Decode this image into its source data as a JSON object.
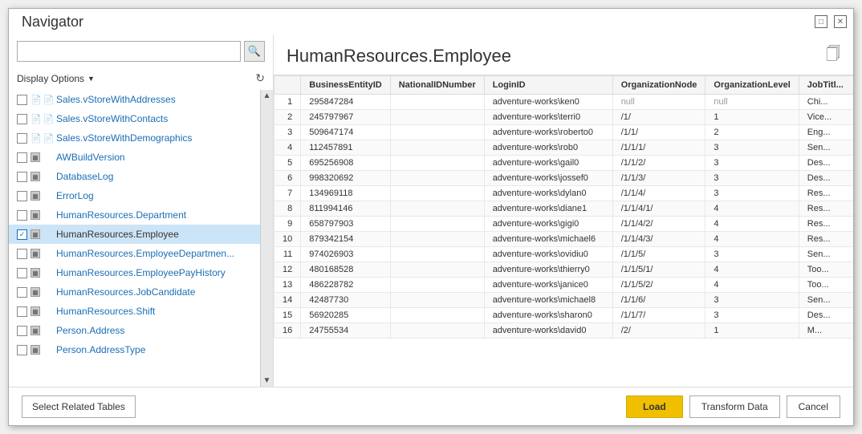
{
  "window": {
    "title": "Navigator"
  },
  "search": {
    "placeholder": "",
    "value": ""
  },
  "display_options": {
    "label": "Display Options",
    "arrow": "▼"
  },
  "list_items": [
    {
      "id": 1,
      "label": "Sales.vStoreWithAddresses",
      "checked": false,
      "type": "view",
      "truncated": true
    },
    {
      "id": 2,
      "label": "Sales.vStoreWithContacts",
      "checked": false,
      "type": "view"
    },
    {
      "id": 3,
      "label": "Sales.vStoreWithDemographics",
      "checked": false,
      "type": "view"
    },
    {
      "id": 4,
      "label": "AWBuildVersion",
      "checked": false,
      "type": "table"
    },
    {
      "id": 5,
      "label": "DatabaseLog",
      "checked": false,
      "type": "table"
    },
    {
      "id": 6,
      "label": "ErrorLog",
      "checked": false,
      "type": "table"
    },
    {
      "id": 7,
      "label": "HumanResources.Department",
      "checked": false,
      "type": "table"
    },
    {
      "id": 8,
      "label": "HumanResources.Employee",
      "checked": true,
      "type": "table",
      "selected": true
    },
    {
      "id": 9,
      "label": "HumanResources.EmployeeDepartmen...",
      "checked": false,
      "type": "table"
    },
    {
      "id": 10,
      "label": "HumanResources.EmployeePayHistory",
      "checked": false,
      "type": "table"
    },
    {
      "id": 11,
      "label": "HumanResources.JobCandidate",
      "checked": false,
      "type": "table"
    },
    {
      "id": 12,
      "label": "HumanResources.Shift",
      "checked": false,
      "type": "table"
    },
    {
      "id": 13,
      "label": "Person.Address",
      "checked": false,
      "type": "table"
    },
    {
      "id": 14,
      "label": "Person.AddressType",
      "checked": false,
      "type": "table"
    }
  ],
  "preview": {
    "title": "HumanResources.Employee",
    "columns": [
      "BusinessEntityID",
      "NationalIDNumber",
      "LoginID",
      "OrganizationNode",
      "OrganizationLevel",
      "JobTitl..."
    ],
    "rows": [
      {
        "num": 1,
        "BusinessEntityID": "295847284",
        "NationalIDNumber": "",
        "LoginID": "adventure-works\\ken0",
        "OrganizationNode": "null",
        "OrganizationLevel": "null",
        "JobTitle": "Chi..."
      },
      {
        "num": 2,
        "BusinessEntityID": "245797967",
        "NationalIDNumber": "",
        "LoginID": "adventure-works\\terri0",
        "OrganizationNode": "/1/",
        "OrganizationLevel": "1",
        "JobTitle": "Vice..."
      },
      {
        "num": 3,
        "BusinessEntityID": "509647174",
        "NationalIDNumber": "",
        "LoginID": "adventure-works\\roberto0",
        "OrganizationNode": "/1/1/",
        "OrganizationLevel": "2",
        "JobTitle": "Eng..."
      },
      {
        "num": 4,
        "BusinessEntityID": "112457891",
        "NationalIDNumber": "",
        "LoginID": "adventure-works\\rob0",
        "OrganizationNode": "/1/1/1/",
        "OrganizationLevel": "3",
        "JobTitle": "Sen..."
      },
      {
        "num": 5,
        "BusinessEntityID": "695256908",
        "NationalIDNumber": "",
        "LoginID": "adventure-works\\gail0",
        "OrganizationNode": "/1/1/2/",
        "OrganizationLevel": "3",
        "JobTitle": "Des..."
      },
      {
        "num": 6,
        "BusinessEntityID": "998320692",
        "NationalIDNumber": "",
        "LoginID": "adventure-works\\jossef0",
        "OrganizationNode": "/1/1/3/",
        "OrganizationLevel": "3",
        "JobTitle": "Des..."
      },
      {
        "num": 7,
        "BusinessEntityID": "134969118",
        "NationalIDNumber": "",
        "LoginID": "adventure-works\\dylan0",
        "OrganizationNode": "/1/1/4/",
        "OrganizationLevel": "3",
        "JobTitle": "Res..."
      },
      {
        "num": 8,
        "BusinessEntityID": "811994146",
        "NationalIDNumber": "",
        "LoginID": "adventure-works\\diane1",
        "OrganizationNode": "/1/1/4/1/",
        "OrganizationLevel": "4",
        "JobTitle": "Res..."
      },
      {
        "num": 9,
        "BusinessEntityID": "658797903",
        "NationalIDNumber": "",
        "LoginID": "adventure-works\\gigi0",
        "OrganizationNode": "/1/1/4/2/",
        "OrganizationLevel": "4",
        "JobTitle": "Res..."
      },
      {
        "num": 10,
        "BusinessEntityID": "879342154",
        "NationalIDNumber": "",
        "LoginID": "adventure-works\\michael6",
        "OrganizationNode": "/1/1/4/3/",
        "OrganizationLevel": "4",
        "JobTitle": "Res..."
      },
      {
        "num": 11,
        "BusinessEntityID": "974026903",
        "NationalIDNumber": "",
        "LoginID": "adventure-works\\ovidiu0",
        "OrganizationNode": "/1/1/5/",
        "OrganizationLevel": "3",
        "JobTitle": "Sen..."
      },
      {
        "num": 12,
        "BusinessEntityID": "480168528",
        "NationalIDNumber": "",
        "LoginID": "adventure-works\\thierry0",
        "OrganizationNode": "/1/1/5/1/",
        "OrganizationLevel": "4",
        "JobTitle": "Too..."
      },
      {
        "num": 13,
        "BusinessEntityID": "486228782",
        "NationalIDNumber": "",
        "LoginID": "adventure-works\\janice0",
        "OrganizationNode": "/1/1/5/2/",
        "OrganizationLevel": "4",
        "JobTitle": "Too..."
      },
      {
        "num": 14,
        "BusinessEntityID": "42487730",
        "NationalIDNumber": "",
        "LoginID": "adventure-works\\michael8",
        "OrganizationNode": "/1/1/6/",
        "OrganizationLevel": "3",
        "JobTitle": "Sen..."
      },
      {
        "num": 15,
        "BusinessEntityID": "56920285",
        "NationalIDNumber": "",
        "LoginID": "adventure-works\\sharon0",
        "OrganizationNode": "/1/1/7/",
        "OrganizationLevel": "3",
        "JobTitle": "Des..."
      },
      {
        "num": 16,
        "BusinessEntityID": "24755534",
        "NationalIDNumber": "",
        "LoginID": "adventure-works\\david0",
        "OrganizationNode": "/2/",
        "OrganizationLevel": "1",
        "JobTitle": "M..."
      }
    ]
  },
  "buttons": {
    "select_related": "Select Related Tables",
    "load": "Load",
    "transform": "Transform Data",
    "cancel": "Cancel"
  }
}
